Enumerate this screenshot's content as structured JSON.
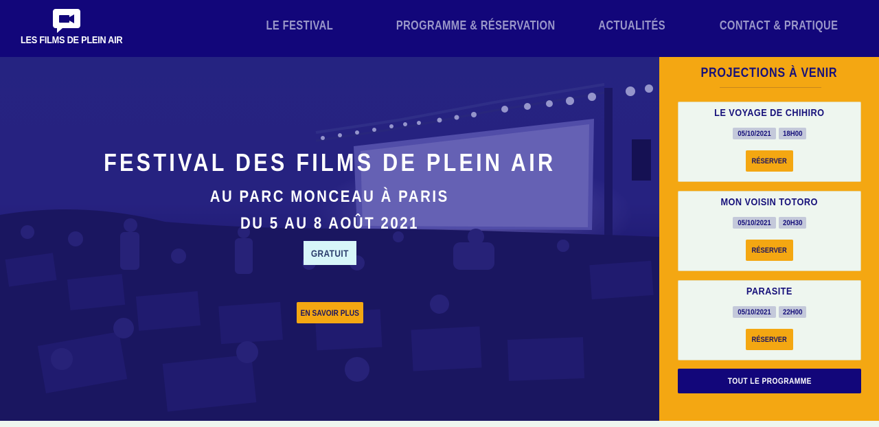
{
  "header": {
    "logo_text": "LES FILMS DE PLEIN AIR",
    "logo_icon": "video-camera-chat-icon",
    "nav": [
      {
        "label": "LE FESTIVAL"
      },
      {
        "label": "PROGRAMME & RÉSERVATION"
      },
      {
        "label": "ACTUALITÉS"
      },
      {
        "label": "CONTACT & PRATIQUE"
      }
    ]
  },
  "hero": {
    "title": "FESTIVAL DES FILMS DE PLEIN AIR",
    "subtitle": "AU PARC MONCEAU À PARIS",
    "dates": "DU 5 AU 8 AOÛT 2021",
    "badge": "GRATUIT",
    "cta": "EN SAVOIR PLUS"
  },
  "sidebar": {
    "title": "PROJECTIONS À VENIR",
    "screenings": [
      {
        "title": "LE VOYAGE DE CHIHIRO",
        "date": "05/10/2021",
        "time": "18H00",
        "button": "RÉSERVER"
      },
      {
        "title": "MON VOISIN TOTORO",
        "date": "05/10/2021",
        "time": "20H30",
        "button": "RÉSERVER"
      },
      {
        "title": "PARASITE",
        "date": "05/10/2021",
        "time": "22H00",
        "button": "RÉSERVER"
      }
    ],
    "all_button": "TOUT LE PROGRAMME"
  },
  "colors": {
    "header_bg": "#12067a",
    "accent_orange": "#f4a712",
    "card_bg": "#eef6ef",
    "nav_text": "#9a97c9",
    "badge_bg": "#d7f6f9"
  }
}
